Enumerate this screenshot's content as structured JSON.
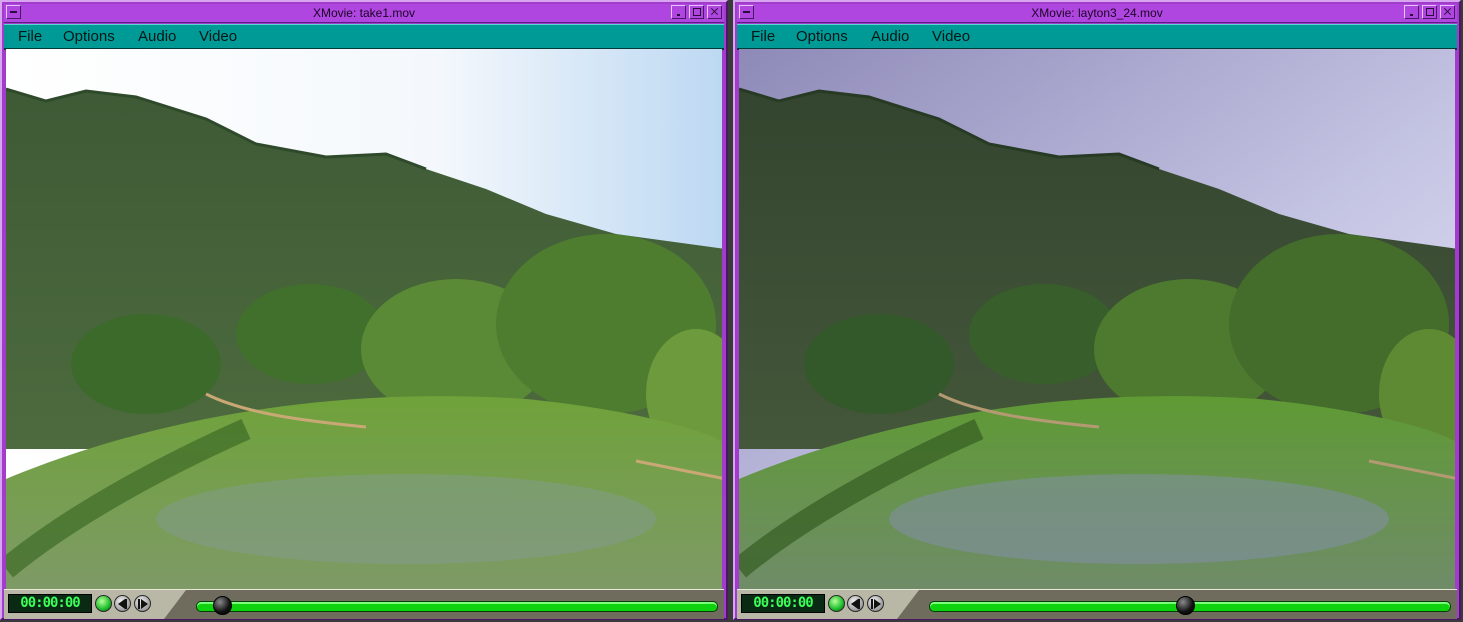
{
  "windows": [
    {
      "title": "XMovie: take1.mov",
      "menu": [
        "File",
        "Options",
        "Audio",
        "Video"
      ],
      "timecode": "00:00:00",
      "playback_position": 0.05,
      "tint": "bright"
    },
    {
      "title": "XMovie: layton3_24.mov",
      "menu": [
        "File",
        "Options",
        "Audio",
        "Video"
      ],
      "timecode": "00:00:00",
      "playback_position": 0.49,
      "tint": "purple"
    }
  ],
  "colors": {
    "window_frame": "#a13ccb",
    "menubar": "#009a96",
    "control_bar": "#b9b7a5",
    "progress_track": "#0fd20f"
  },
  "icons": [
    "window-menu-icon",
    "minimize-icon",
    "maximize-icon",
    "close-icon",
    "play-icon",
    "step-back-icon",
    "step-forward-icon",
    "seek-thumb-icon"
  ]
}
